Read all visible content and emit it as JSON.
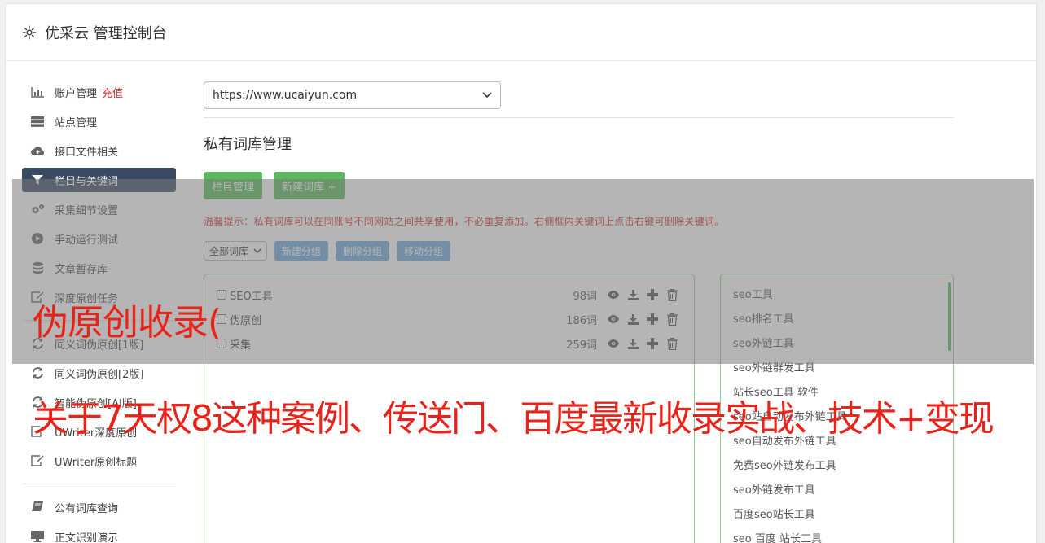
{
  "header": {
    "title": "优采云 管理控制台",
    "icon": "gear-icon"
  },
  "sidebar": {
    "groups": [
      [
        {
          "label": "账户管理",
          "icon": "bar-chart-icon",
          "badge": "充值",
          "active": false
        },
        {
          "label": "站点管理",
          "icon": "server-icon",
          "active": false
        },
        {
          "label": "接口文件相关",
          "icon": "cloud-upload-icon",
          "active": false
        },
        {
          "label": "栏目与关键词",
          "icon": "filter-icon",
          "active": true
        },
        {
          "label": "采集细节设置",
          "icon": "cogs-icon",
          "active": false
        },
        {
          "label": "手动运行测试",
          "icon": "play-circle-icon",
          "active": false
        },
        {
          "label": "文章暂存库",
          "icon": "database-icon",
          "active": false
        },
        {
          "label": "深度原创任务",
          "icon": "edit-icon",
          "active": false
        }
      ],
      [
        {
          "label": "同义词伪原创[1版]",
          "icon": "refresh-icon",
          "active": false
        },
        {
          "label": "同义词伪原创[2版]",
          "icon": "refresh-icon",
          "active": false
        },
        {
          "label": "智能伪原创[AI版]",
          "icon": "refresh-icon",
          "active": false
        },
        {
          "label": "UWriter深度原创",
          "icon": "edit-icon",
          "active": false
        },
        {
          "label": "UWriter原创标题",
          "icon": "edit-icon",
          "active": false
        }
      ],
      [
        {
          "label": "公有词库查询",
          "icon": "book-icon",
          "active": false
        },
        {
          "label": "正文识别演示",
          "icon": "desktop-icon",
          "active": false
        }
      ]
    ]
  },
  "main": {
    "site_select": "https://www.ucaiyun.com",
    "heading": "私有词库管理",
    "buttons": {
      "column_manage": "栏目管理",
      "new_lexicon": "新建词库 +"
    },
    "tip": "温馨提示：私有词库可以在同账号不同网站之间共享使用，不必重复添加。右侧框内关键词上点击右键可删除关键词。",
    "group_select": "全部词库",
    "group_buttons": {
      "new": "新建分组",
      "delete": "删除分组",
      "move": "移动分组"
    },
    "lexicons": [
      {
        "name": "SEO工具",
        "count": "98词"
      },
      {
        "name": "伪原创",
        "count": "186词"
      },
      {
        "name": "采集",
        "count": "259词"
      }
    ],
    "keywords": [
      "seo工具",
      "seo排名工具",
      "seo外链工具",
      "seo外链群发工具",
      "站长seo工具 软件",
      "seo站自动发布外链工具",
      "seo自动发布外链工具",
      "免费seo外链发布工具",
      "seo外链发布工具",
      "百度seo站长工具",
      "seo 百度 站长工具"
    ]
  },
  "overlay": {
    "line1": "伪原创收录(",
    "line2": "关于7天权8这种案例、传送门、百度最新收录实战、技术+变现"
  },
  "colors": {
    "active_nav": "#3b4a63",
    "green": "#5cb85c",
    "blue": "#6fa8dc",
    "red": "#d9302a"
  }
}
